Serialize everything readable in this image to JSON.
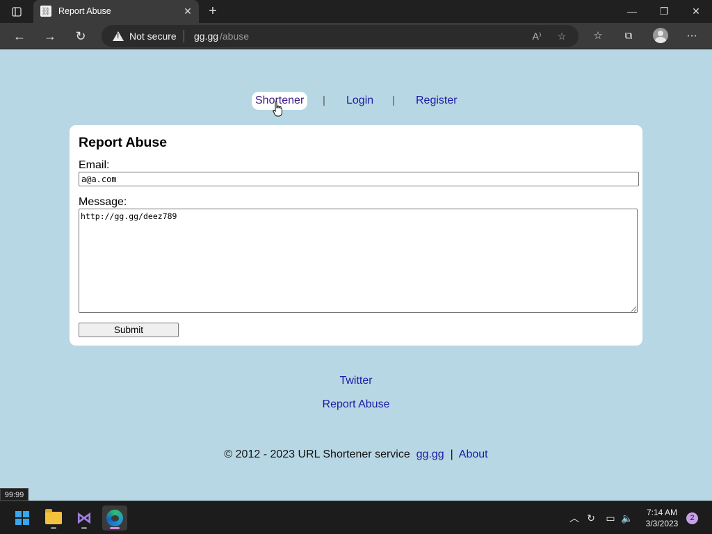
{
  "browser": {
    "tab_title": "Report Abuse",
    "security_label": "Not secure",
    "url_host": "gg.gg",
    "url_path": "/abuse"
  },
  "nav": {
    "items": [
      {
        "label": "Shortener"
      },
      {
        "label": "Login"
      },
      {
        "label": "Register"
      }
    ],
    "separator": "|"
  },
  "form": {
    "title": "Report Abuse",
    "email_label": "Email:",
    "email_value": "a@a.com",
    "message_label": "Message:",
    "message_value": "http://gg.gg/deez789",
    "submit_label": "Submit"
  },
  "footer": {
    "twitter_label": "Twitter",
    "report_label": "Report Abuse",
    "copyright_text": "© 2012 - 2023 URL Shortener service",
    "site_link": "gg.gg",
    "separator": "|",
    "about_label": "About"
  },
  "tooltip": "99:99",
  "taskbar": {
    "time": "7:14 AM",
    "date": "3/3/2023",
    "notification_count": "2"
  },
  "colors": {
    "page_background": "#b8d7e4",
    "link": "#1b1ba6",
    "card": "#ffffff"
  }
}
